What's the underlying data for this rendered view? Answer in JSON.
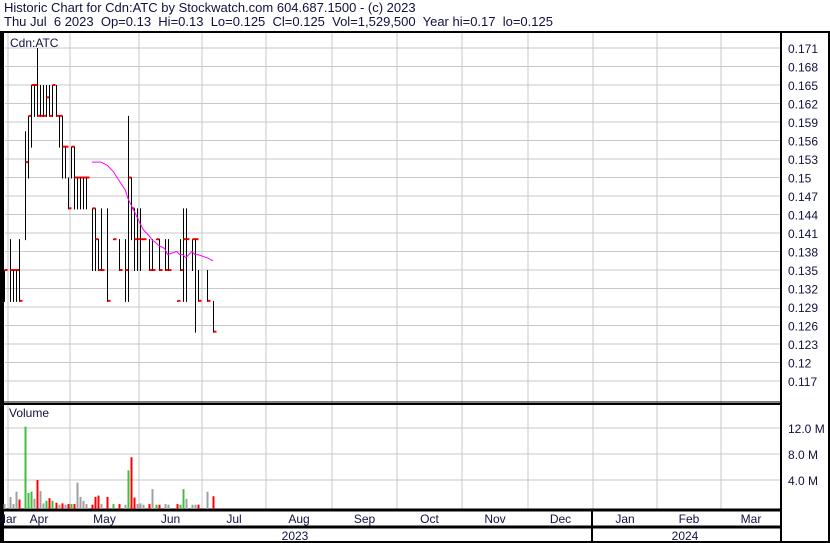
{
  "header": {
    "title": "Historic Chart for Cdn:ATC by Stockwatch.com 604.687.1500 - (c) 2023",
    "summary": "Thu Jul  6 2023  Op=0.13  Hi=0.13  Lo=0.125  Cl=0.125  Vol=1,529,500  Year hi=0.17  lo=0.125"
  },
  "colors": {
    "up": "#44bb44",
    "down": "#ff0000",
    "unchanged": "#a0a0a0",
    "close_tick": "#ff0000",
    "ma": "#ff00ff",
    "grid": "#c8c8c8"
  },
  "chart_data": {
    "type": "ohlc",
    "symbol_label": "Cdn:ATC",
    "volume_label": "Volume",
    "price_ticks": [
      "0.171",
      "0.168",
      "0.165",
      "0.162",
      "0.159",
      "0.156",
      "0.153",
      "0.15",
      "0.147",
      "0.144",
      "0.141",
      "0.138",
      "0.135",
      "0.132",
      "0.129",
      "0.126",
      "0.123",
      "0.12",
      "0.117"
    ],
    "price_range": [
      0.1155,
      0.1735
    ],
    "volume_ticks": [
      "12.0 M",
      "8.0 M",
      "4.0 M"
    ],
    "volume_range_M": [
      0,
      16
    ],
    "months": [
      "Mar",
      "Apr",
      "May",
      "Jun",
      "Jul",
      "Aug",
      "Sep",
      "Oct",
      "Nov",
      "Dec",
      "Jan",
      "Feb",
      "Mar"
    ],
    "years": [
      "2023",
      "2024"
    ],
    "bars": [
      {
        "h": 0.135,
        "l": 0.13,
        "c": 0.135,
        "v": 0.3
      },
      {
        "h": 0.14,
        "l": 0.13,
        "c": 0.135,
        "v": 1.4
      },
      {
        "h": 0.135,
        "l": 0.13,
        "c": 0.135,
        "v": 0.3
      },
      {
        "h": 0.135,
        "l": 0.13,
        "c": 0.135,
        "v": 2.2
      },
      {
        "h": 0.14,
        "l": 0.13,
        "c": 0.13,
        "v": 1.0
      },
      {
        "h": 0.1575,
        "l": 0.14,
        "c": 0.1525,
        "v": 12.2
      },
      {
        "h": 0.16,
        "l": 0.15,
        "c": 0.16,
        "v": 2.0
      },
      {
        "h": 0.165,
        "l": 0.155,
        "c": 0.165,
        "v": 2.2
      },
      {
        "h": 0.165,
        "l": 0.16,
        "c": 0.165,
        "v": 1.1
      },
      {
        "h": 0.171,
        "l": 0.16,
        "c": 0.16,
        "v": 4.0
      },
      {
        "h": 0.165,
        "l": 0.16,
        "c": 0.16,
        "v": 2.3
      },
      {
        "h": 0.165,
        "l": 0.16,
        "c": 0.16,
        "v": 0.4
      },
      {
        "h": 0.165,
        "l": 0.16,
        "c": 0.163,
        "v": 0.8
      },
      {
        "h": 0.165,
        "l": 0.16,
        "c": 0.16,
        "v": 1.2
      },
      {
        "h": 0.165,
        "l": 0.16,
        "c": 0.165,
        "v": 0.8
      },
      {
        "h": 0.165,
        "l": 0.16,
        "c": 0.16,
        "v": 0.5
      },
      {
        "h": 0.16,
        "l": 0.155,
        "c": 0.16,
        "v": 0.2
      },
      {
        "h": 0.16,
        "l": 0.15,
        "c": 0.155,
        "v": 0.4
      },
      {
        "h": 0.155,
        "l": 0.15,
        "c": 0.155,
        "v": 0.2
      },
      {
        "h": 0.15,
        "l": 0.145,
        "c": 0.145,
        "v": 0.3
      },
      {
        "h": 0.155,
        "l": 0.15,
        "c": 0.155,
        "v": 0.3
      },
      {
        "h": 0.155,
        "l": 0.145,
        "c": 0.15,
        "v": 0.3
      },
      {
        "h": 0.15,
        "l": 0.145,
        "c": 0.15,
        "v": 3.6
      },
      {
        "h": 0.15,
        "l": 0.145,
        "c": 0.15,
        "v": 1.4
      },
      {
        "h": 0.15,
        "l": 0.145,
        "c": 0.15,
        "v": 0.8
      },
      {
        "h": 0.15,
        "l": 0.145,
        "c": 0.15,
        "v": 0.3
      },
      {
        "h": 0.145,
        "l": 0.135,
        "c": 0.145,
        "v": 0.2
      },
      {
        "h": 0.145,
        "l": 0.135,
        "c": 0.14,
        "v": 1.4
      },
      {
        "h": 0.14,
        "l": 0.135,
        "c": 0.135,
        "v": 1.6
      },
      {
        "h": 0.145,
        "l": 0.135,
        "c": 0.135,
        "v": 0.3
      },
      {
        "h": 0.145,
        "l": 0.13,
        "c": 0.13,
        "v": 1.4
      },
      {
        "h": 0.14,
        "l": 0.14,
        "c": 0.14,
        "v": 0.3
      },
      {
        "h": 0.14,
        "l": 0.135,
        "c": 0.135,
        "v": 0.3
      },
      {
        "h": 0.14,
        "l": 0.13,
        "c": 0.135,
        "v": 0.2
      },
      {
        "h": 0.16,
        "l": 0.13,
        "c": 0.15,
        "v": 5.5
      },
      {
        "h": 0.15,
        "l": 0.14,
        "c": 0.145,
        "v": 7.5
      },
      {
        "h": 0.145,
        "l": 0.135,
        "c": 0.14,
        "v": 1.3
      },
      {
        "h": 0.145,
        "l": 0.135,
        "c": 0.14,
        "v": 0.3
      },
      {
        "h": 0.145,
        "l": 0.135,
        "c": 0.14,
        "v": 0.4
      },
      {
        "h": 0.14,
        "l": 0.14,
        "c": 0.14,
        "v": 0.2
      },
      {
        "h": 0.14,
        "l": 0.135,
        "c": 0.135,
        "v": 0.3
      },
      {
        "h": 0.14,
        "l": 0.135,
        "c": 0.135,
        "v": 2.6
      },
      {
        "h": 0.14,
        "l": 0.14,
        "c": 0.14,
        "v": 0.2
      },
      {
        "h": 0.14,
        "l": 0.135,
        "c": 0.135,
        "v": 0.2
      },
      {
        "h": 0.14,
        "l": 0.135,
        "c": 0.135,
        "v": 0.3
      },
      {
        "h": 0.14,
        "l": 0.135,
        "c": 0.135,
        "v": 0.2
      },
      {
        "h": 0.13,
        "l": 0.13,
        "c": 0.13,
        "v": 0.3
      },
      {
        "h": 0.14,
        "l": 0.135,
        "c": 0.135,
        "v": 0.2
      },
      {
        "h": 0.145,
        "l": 0.13,
        "c": 0.14,
        "v": 2.6
      },
      {
        "h": 0.145,
        "l": 0.13,
        "c": 0.14,
        "v": 1.1
      },
      {
        "h": 0.14,
        "l": 0.135,
        "c": 0.14,
        "v": 0.2
      },
      {
        "h": 0.14,
        "l": 0.125,
        "c": 0.14,
        "v": 0.2
      },
      {
        "h": 0.135,
        "l": 0.13,
        "c": 0.13,
        "v": 0.2
      },
      {
        "h": 0.135,
        "l": 0.13,
        "c": 0.13,
        "v": 2.2
      },
      {
        "h": 0.13,
        "l": 0.125,
        "c": 0.125,
        "v": 1.5
      }
    ],
    "bar_x_days": [
      0,
      2,
      3,
      4,
      5,
      7,
      8,
      9,
      10,
      11,
      12,
      13,
      14,
      15,
      16,
      17,
      18,
      19,
      20,
      21,
      22,
      23,
      24,
      25,
      26,
      27,
      29,
      30,
      31,
      32,
      34,
      36,
      38,
      40,
      41,
      42,
      43,
      44,
      45,
      46,
      48,
      49,
      50,
      51,
      53,
      54,
      57,
      58,
      59,
      60,
      62,
      63,
      64,
      67,
      69
    ],
    "moving_average": {
      "start_index": 26,
      "values": [
        0.1525,
        0.1525,
        0.1525,
        0.1525,
        0.152,
        0.151,
        0.1495,
        0.148,
        0.1465,
        0.1455,
        0.1445,
        0.1435,
        0.1425,
        0.1415,
        0.1405,
        0.1398,
        0.1395,
        0.139,
        0.1385,
        0.1375,
        0.138,
        0.1375,
        0.1375,
        0.137,
        0.138,
        0.1375,
        0.1375,
        0.137,
        0.1365
      ]
    }
  }
}
